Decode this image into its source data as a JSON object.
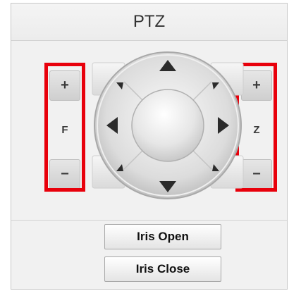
{
  "panel": {
    "title": "PTZ"
  },
  "focus": {
    "plus_label": "+",
    "label": "F",
    "minus_label": "−"
  },
  "zoom": {
    "plus_label": "+",
    "label": "Z",
    "minus_label": "−"
  },
  "iris": {
    "open_label": "Iris Open",
    "close_label": "Iris Close"
  },
  "colors": {
    "highlight": "#e8000b",
    "panel_bg": "#f1f1f1",
    "arrow": "#2b2b2b"
  },
  "icons": {
    "up": "up-arrow-icon",
    "down": "down-arrow-icon",
    "left": "left-arrow-icon",
    "right": "right-arrow-icon",
    "up_left": "up-left-arrow-icon",
    "up_right": "up-right-arrow-icon",
    "down_left": "down-left-arrow-icon",
    "down_right": "down-right-arrow-icon"
  }
}
